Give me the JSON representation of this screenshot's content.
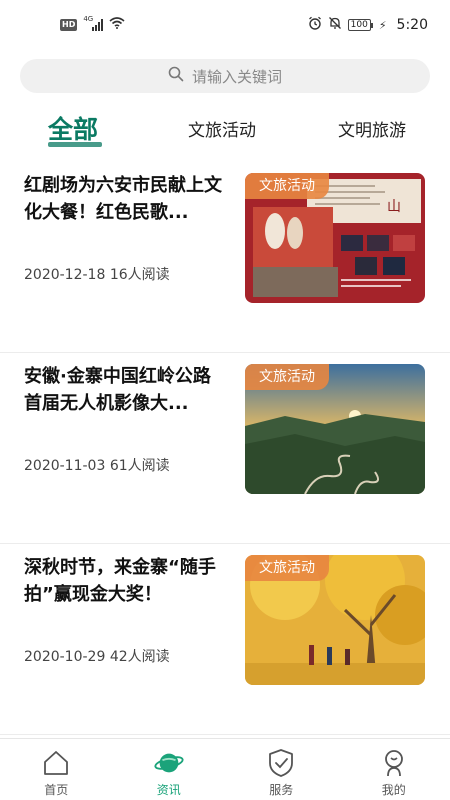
{
  "status_bar": {
    "hd": "HD",
    "network": "4G",
    "battery": "100",
    "time": "5:20"
  },
  "search": {
    "placeholder": "请输入关键词"
  },
  "tabs": [
    {
      "label": "全部",
      "active": true
    },
    {
      "label": "文旅活动",
      "active": false
    },
    {
      "label": "文明旅游",
      "active": false
    }
  ],
  "news": [
    {
      "title": "红剧场为六安市民献上文化大餐！红色民歌...",
      "date": "2020-12-18",
      "reads": "16人阅读",
      "tag": "文旅活动",
      "image": "red-theater-poster"
    },
    {
      "title": "安徽·金寨中国红岭公路首届无人机影像大...",
      "date": "2020-11-03",
      "reads": "61人阅读",
      "tag": "文旅活动",
      "image": "mountain-road-sunset"
    },
    {
      "title": "深秋时节，来金寨“随手拍”赢现金大奖！",
      "date": "2020-10-29",
      "reads": "42人阅读",
      "tag": "文旅活动",
      "image": "autumn-ginkgo-tree"
    }
  ],
  "bottom_nav": [
    {
      "label": "首页",
      "icon": "home-icon",
      "active": false
    },
    {
      "label": "资讯",
      "icon": "planet-icon",
      "active": true
    },
    {
      "label": "服务",
      "icon": "shield-check-icon",
      "active": false
    },
    {
      "label": "我的",
      "icon": "user-icon",
      "active": false
    }
  ],
  "colors": {
    "accent": "#0b7a63",
    "nav_active": "#1ba37a",
    "tag_bg": "#e88640"
  }
}
